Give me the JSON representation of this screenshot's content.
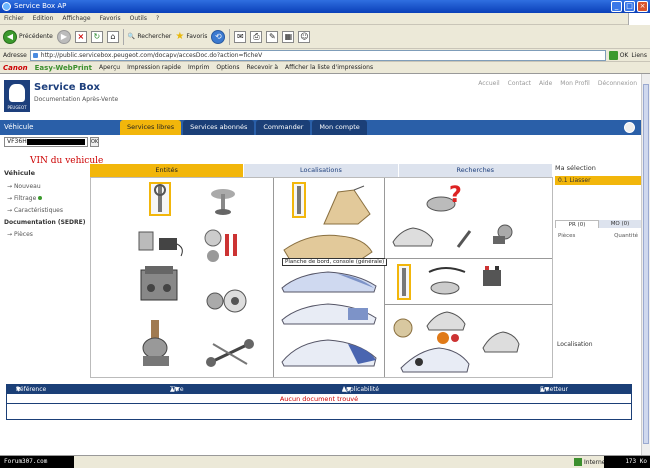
{
  "window": {
    "title": "Service Box AP"
  },
  "menubar": [
    "Fichier",
    "Edition",
    "Affichage",
    "Favoris",
    "Outils",
    "?"
  ],
  "toolbar": {
    "back_label": "Précédente",
    "search_label": "Rechercher",
    "favorites_label": "Favoris"
  },
  "addressbar": {
    "label": "Adresse",
    "url": "http://public.servicebox.peugeot.com/docapv/accesDoc.do?action=ficheV",
    "go_label": "OK",
    "links_label": "Liens"
  },
  "canonbar": {
    "canon": "Canon",
    "easy": "Easy-WebPrint",
    "items": [
      "Aperçu",
      "Impression rapide",
      "Imprim",
      "Options",
      "Recevoir à",
      "Afficher la liste d'impressions"
    ]
  },
  "header": {
    "brand_title": "Service Box",
    "brand_sub": "Documentation Après-Vente",
    "logo_text": "PEUGEOT",
    "toplinks": [
      "Accueil",
      "Contact",
      "Aide",
      "Mon Profil",
      "Déconnexion"
    ]
  },
  "nav": {
    "vehicle_label": "Véhicule",
    "tabs": [
      "Services libres",
      "Services abonnés",
      "Commander",
      "Mon compte"
    ]
  },
  "vin": {
    "value": "VF36H",
    "ok_label": "OK",
    "annotation": "VIN du vehicule"
  },
  "leftnav": {
    "heading": "Véhicule",
    "items": [
      "Nouveau",
      "Filtrage",
      "Caractéristiques",
      "Documentation (SEDRE)",
      "Pièces"
    ]
  },
  "catalog": {
    "tabs": [
      "Entités",
      "Localisations",
      "Recherches"
    ],
    "tooltip": "Planche de bord, console (générale)"
  },
  "selection": {
    "heading": "Ma sélection",
    "bar": "0.1 Liasser",
    "tabs": [
      "PR (0)",
      "MO (0)"
    ],
    "sub": [
      "Pièces",
      "Quantité"
    ],
    "localisation": "Localisation"
  },
  "documents": {
    "columns": [
      "Référence",
      "Titre",
      "Applicabilité",
      "Emetteur"
    ],
    "empty_message": "Aucun document trouvé"
  },
  "statusbar": {
    "forum": "Forum307.com",
    "zone": "Internet",
    "size": "173 Ko"
  },
  "colors": {
    "accent": "#f2b60b",
    "brand": "#1d3f7c",
    "band": "#2a5fa8"
  }
}
